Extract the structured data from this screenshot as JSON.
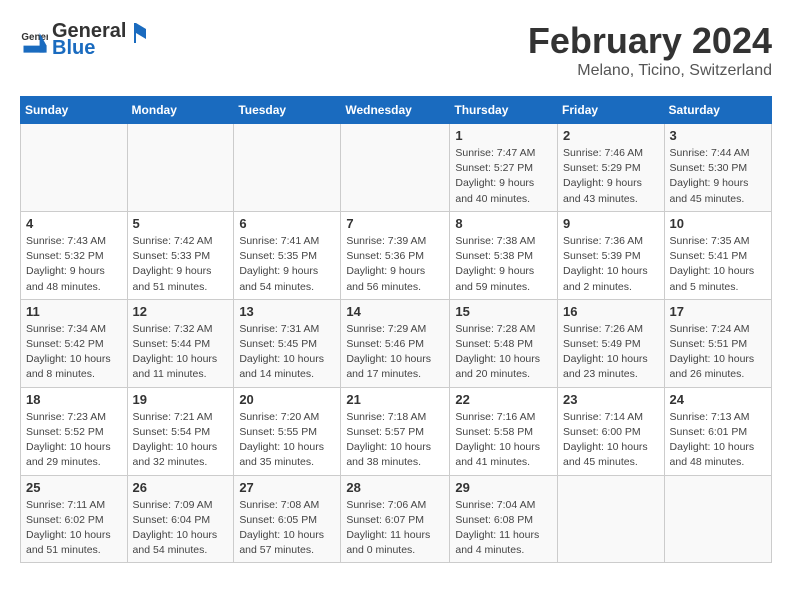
{
  "header": {
    "logo_general": "General",
    "logo_blue": "Blue",
    "title": "February 2024",
    "subtitle": "Melano, Ticino, Switzerland"
  },
  "columns": [
    "Sunday",
    "Monday",
    "Tuesday",
    "Wednesday",
    "Thursday",
    "Friday",
    "Saturday"
  ],
  "weeks": [
    [
      {
        "day": "",
        "info": ""
      },
      {
        "day": "",
        "info": ""
      },
      {
        "day": "",
        "info": ""
      },
      {
        "day": "",
        "info": ""
      },
      {
        "day": "1",
        "info": "Sunrise: 7:47 AM\nSunset: 5:27 PM\nDaylight: 9 hours\nand 40 minutes."
      },
      {
        "day": "2",
        "info": "Sunrise: 7:46 AM\nSunset: 5:29 PM\nDaylight: 9 hours\nand 43 minutes."
      },
      {
        "day": "3",
        "info": "Sunrise: 7:44 AM\nSunset: 5:30 PM\nDaylight: 9 hours\nand 45 minutes."
      }
    ],
    [
      {
        "day": "4",
        "info": "Sunrise: 7:43 AM\nSunset: 5:32 PM\nDaylight: 9 hours\nand 48 minutes."
      },
      {
        "day": "5",
        "info": "Sunrise: 7:42 AM\nSunset: 5:33 PM\nDaylight: 9 hours\nand 51 minutes."
      },
      {
        "day": "6",
        "info": "Sunrise: 7:41 AM\nSunset: 5:35 PM\nDaylight: 9 hours\nand 54 minutes."
      },
      {
        "day": "7",
        "info": "Sunrise: 7:39 AM\nSunset: 5:36 PM\nDaylight: 9 hours\nand 56 minutes."
      },
      {
        "day": "8",
        "info": "Sunrise: 7:38 AM\nSunset: 5:38 PM\nDaylight: 9 hours\nand 59 minutes."
      },
      {
        "day": "9",
        "info": "Sunrise: 7:36 AM\nSunset: 5:39 PM\nDaylight: 10 hours\nand 2 minutes."
      },
      {
        "day": "10",
        "info": "Sunrise: 7:35 AM\nSunset: 5:41 PM\nDaylight: 10 hours\nand 5 minutes."
      }
    ],
    [
      {
        "day": "11",
        "info": "Sunrise: 7:34 AM\nSunset: 5:42 PM\nDaylight: 10 hours\nand 8 minutes."
      },
      {
        "day": "12",
        "info": "Sunrise: 7:32 AM\nSunset: 5:44 PM\nDaylight: 10 hours\nand 11 minutes."
      },
      {
        "day": "13",
        "info": "Sunrise: 7:31 AM\nSunset: 5:45 PM\nDaylight: 10 hours\nand 14 minutes."
      },
      {
        "day": "14",
        "info": "Sunrise: 7:29 AM\nSunset: 5:46 PM\nDaylight: 10 hours\nand 17 minutes."
      },
      {
        "day": "15",
        "info": "Sunrise: 7:28 AM\nSunset: 5:48 PM\nDaylight: 10 hours\nand 20 minutes."
      },
      {
        "day": "16",
        "info": "Sunrise: 7:26 AM\nSunset: 5:49 PM\nDaylight: 10 hours\nand 23 minutes."
      },
      {
        "day": "17",
        "info": "Sunrise: 7:24 AM\nSunset: 5:51 PM\nDaylight: 10 hours\nand 26 minutes."
      }
    ],
    [
      {
        "day": "18",
        "info": "Sunrise: 7:23 AM\nSunset: 5:52 PM\nDaylight: 10 hours\nand 29 minutes."
      },
      {
        "day": "19",
        "info": "Sunrise: 7:21 AM\nSunset: 5:54 PM\nDaylight: 10 hours\nand 32 minutes."
      },
      {
        "day": "20",
        "info": "Sunrise: 7:20 AM\nSunset: 5:55 PM\nDaylight: 10 hours\nand 35 minutes."
      },
      {
        "day": "21",
        "info": "Sunrise: 7:18 AM\nSunset: 5:57 PM\nDaylight: 10 hours\nand 38 minutes."
      },
      {
        "day": "22",
        "info": "Sunrise: 7:16 AM\nSunset: 5:58 PM\nDaylight: 10 hours\nand 41 minutes."
      },
      {
        "day": "23",
        "info": "Sunrise: 7:14 AM\nSunset: 6:00 PM\nDaylight: 10 hours\nand 45 minutes."
      },
      {
        "day": "24",
        "info": "Sunrise: 7:13 AM\nSunset: 6:01 PM\nDaylight: 10 hours\nand 48 minutes."
      }
    ],
    [
      {
        "day": "25",
        "info": "Sunrise: 7:11 AM\nSunset: 6:02 PM\nDaylight: 10 hours\nand 51 minutes."
      },
      {
        "day": "26",
        "info": "Sunrise: 7:09 AM\nSunset: 6:04 PM\nDaylight: 10 hours\nand 54 minutes."
      },
      {
        "day": "27",
        "info": "Sunrise: 7:08 AM\nSunset: 6:05 PM\nDaylight: 10 hours\nand 57 minutes."
      },
      {
        "day": "28",
        "info": "Sunrise: 7:06 AM\nSunset: 6:07 PM\nDaylight: 11 hours\nand 0 minutes."
      },
      {
        "day": "29",
        "info": "Sunrise: 7:04 AM\nSunset: 6:08 PM\nDaylight: 11 hours\nand 4 minutes."
      },
      {
        "day": "",
        "info": ""
      },
      {
        "day": "",
        "info": ""
      }
    ]
  ]
}
